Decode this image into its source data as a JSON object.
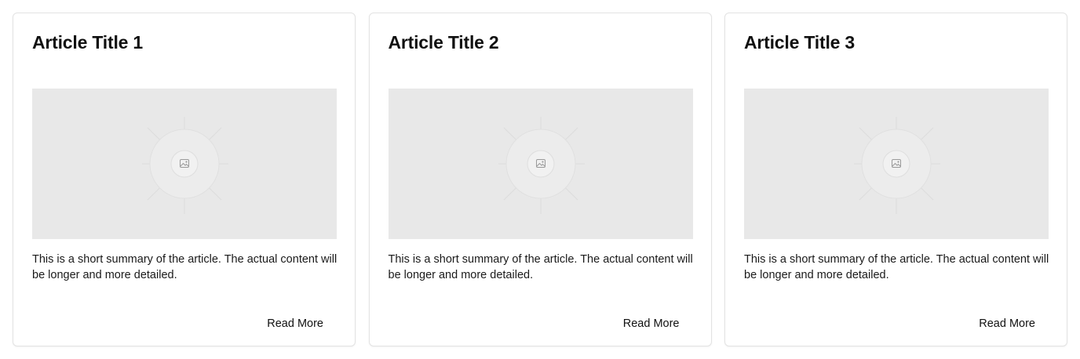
{
  "cards": [
    {
      "title": "Article Title 1",
      "image_icon": "image-placeholder-icon",
      "summary": "This is a short summary of the article. The actual content will be longer and more detailed.",
      "button_label": "Read More"
    },
    {
      "title": "Article Title 2",
      "image_icon": "image-placeholder-icon",
      "summary": "This is a short summary of the article. The actual content will be longer and more detailed.",
      "button_label": "Read More"
    },
    {
      "title": "Article Title 3",
      "image_icon": "image-placeholder-icon",
      "summary": "This is a short summary of the article. The actual content will be longer and more detailed.",
      "button_label": "Read More"
    }
  ],
  "colors": {
    "background": "#ffffff",
    "card_border": "#e3e3e3",
    "image_placeholder": "#e8e8e8",
    "text": "#111111"
  }
}
